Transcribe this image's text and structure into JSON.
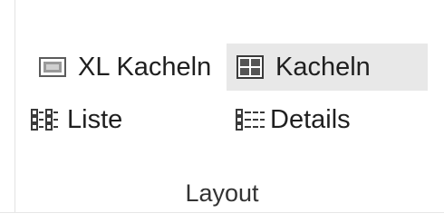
{
  "ribbon_group": {
    "label": "Layout",
    "items": [
      {
        "label": "XL Kacheln",
        "icon": "extra-large-icons-icon",
        "selected": false
      },
      {
        "label": "Kacheln",
        "icon": "tiles-icon",
        "selected": true
      },
      {
        "label": "Liste",
        "icon": "list-icon",
        "selected": false
      },
      {
        "label": "Details",
        "icon": "details-icon",
        "selected": false
      }
    ]
  },
  "colors": {
    "selected_background": "#e8e8e8",
    "text": "#1f1f1f",
    "separator": "#e3e3e3"
  }
}
